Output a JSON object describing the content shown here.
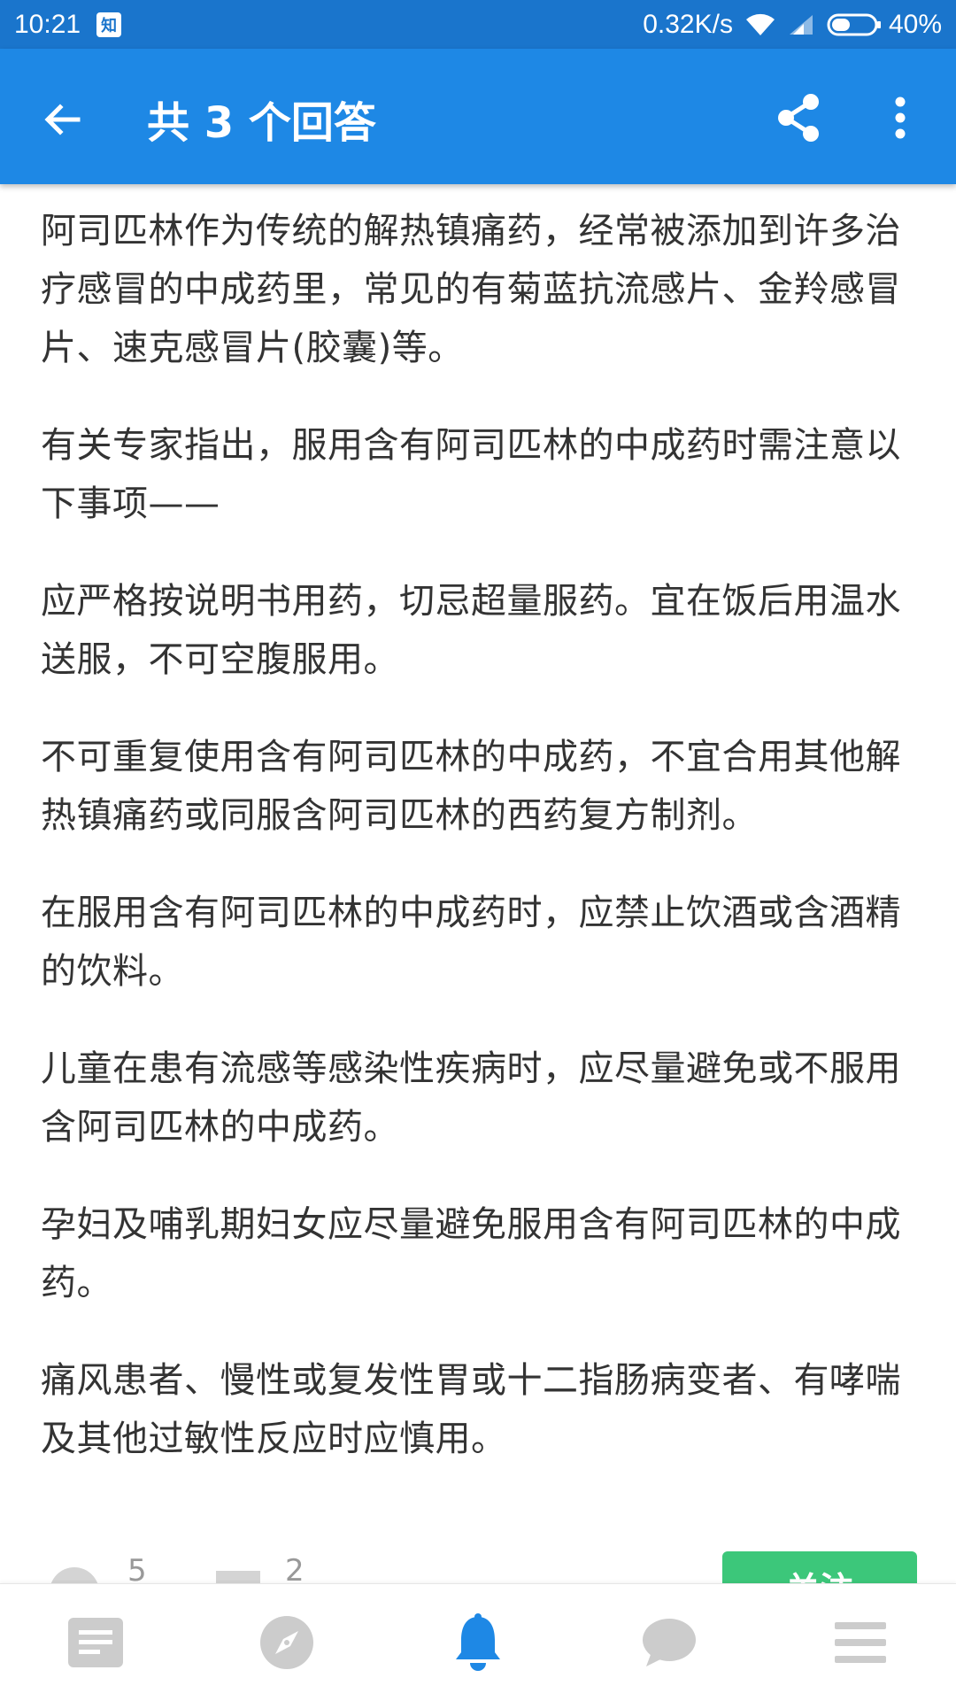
{
  "status_bar": {
    "time": "10:21",
    "notification_badge": "知",
    "network_speed": "0.32K/s",
    "battery": "40%",
    "icons": [
      "wifi-icon",
      "signal-icon",
      "battery-icon"
    ]
  },
  "app_bar": {
    "title": "共 3 个回答",
    "icons": [
      "back-arrow-icon",
      "share-icon",
      "more-vert-icon"
    ]
  },
  "answer": {
    "paragraphs": [
      "阿司匹林作为传统的解热镇痛药，经常被添加到许多治疗感冒的中成药里，常见的有菊蓝抗流感片、金羚感冒片、速克感冒片(胶囊)等。",
      "有关专家指出，服用含有阿司匹林的中成药时需注意以下事项——",
      "应严格按说明书用药，切忌超量服药。宜在饭后用温水送服，不可空腹服用。",
      "不可重复使用含有阿司匹林的中成药，不宜合用其他解热镇痛药或同服含阿司匹林的西药复方制剂。",
      "在服用含有阿司匹林的中成药时，应禁止饮酒或含酒精的饮料。",
      "儿童在患有流感等感染性疾病时，应尽量避免或不服用含阿司匹林的中成药。",
      "孕妇及哺乳期妇女应尽量避免服用含有阿司匹林的中成药。",
      "痛风患者、慢性或复发性胃或十二指肠病变者、有哮喘及其他过敏性反应时应慎用。"
    ]
  },
  "actions": {
    "like_count": "5",
    "comment_count": "2",
    "follow_label": "关注"
  },
  "bottom_nav": {
    "items": [
      "feed-icon",
      "explore-icon",
      "notifications-icon",
      "messages-icon",
      "menu-icon"
    ],
    "active_item": "notifications-icon"
  },
  "colors": {
    "status_bar": "#1a75cc",
    "app_bar": "#1e88e5",
    "accent": "#1e88e5",
    "follow_button": "#3cc77a",
    "inactive_icon": "#cccccc",
    "body_text": "#333333"
  }
}
